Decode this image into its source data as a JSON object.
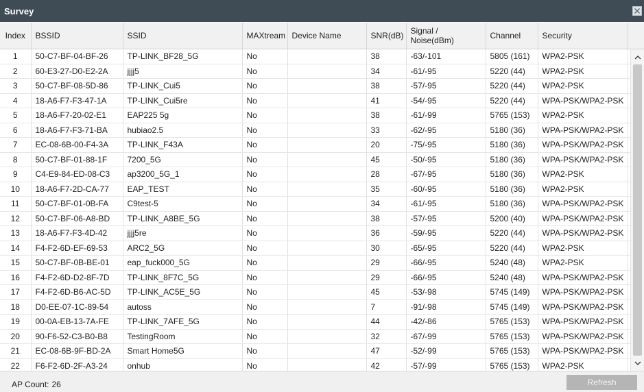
{
  "window": {
    "title": "Survey"
  },
  "table": {
    "headers": {
      "index": "Index",
      "bssid": "BSSID",
      "ssid": "SSID",
      "maxtream": "MAXtream",
      "device_name": "Device Name",
      "snr": "SNR(dB)",
      "signal_line1": "Signal /",
      "signal_line2": "Noise(dBm)",
      "channel": "Channel",
      "security": "Security"
    },
    "rows": [
      {
        "index": "1",
        "bssid": "50-C7-BF-04-BF-26",
        "ssid": "TP-LINK_BF28_5G",
        "maxtream": "No",
        "device_name": "",
        "snr": "38",
        "signal": "-63/-101",
        "channel": "5805 (161)",
        "security": "WPA2-PSK"
      },
      {
        "index": "2",
        "bssid": "60-E3-27-D0-E2-2A",
        "ssid": "jjjj5",
        "maxtream": "No",
        "device_name": "",
        "snr": "34",
        "signal": "-61/-95",
        "channel": "5220 (44)",
        "security": "WPA2-PSK"
      },
      {
        "index": "3",
        "bssid": "50-C7-BF-08-5D-86",
        "ssid": "TP-LINK_Cui5",
        "maxtream": "No",
        "device_name": "",
        "snr": "38",
        "signal": "-57/-95",
        "channel": "5220 (44)",
        "security": "WPA2-PSK"
      },
      {
        "index": "4",
        "bssid": "18-A6-F7-F3-47-1A",
        "ssid": "TP-LINK_Cui5re",
        "maxtream": "No",
        "device_name": "",
        "snr": "41",
        "signal": "-54/-95",
        "channel": "5220 (44)",
        "security": "WPA-PSK/WPA2-PSK"
      },
      {
        "index": "5",
        "bssid": "18-A6-F7-20-02-E1",
        "ssid": "EAP225 5g",
        "maxtream": "No",
        "device_name": "",
        "snr": "38",
        "signal": "-61/-99",
        "channel": "5765 (153)",
        "security": "WPA2-PSK"
      },
      {
        "index": "6",
        "bssid": "18-A6-F7-F3-71-BA",
        "ssid": "hubiao2.5",
        "maxtream": "No",
        "device_name": "",
        "snr": "33",
        "signal": "-62/-95",
        "channel": "5180 (36)",
        "security": "WPA-PSK/WPA2-PSK"
      },
      {
        "index": "7",
        "bssid": "EC-08-6B-00-F4-3A",
        "ssid": "TP-LINK_F43A",
        "maxtream": "No",
        "device_name": "",
        "snr": "20",
        "signal": "-75/-95",
        "channel": "5180 (36)",
        "security": "WPA-PSK/WPA2-PSK"
      },
      {
        "index": "8",
        "bssid": "50-C7-BF-01-88-1F",
        "ssid": "7200_5G",
        "maxtream": "No",
        "device_name": "",
        "snr": "45",
        "signal": "-50/-95",
        "channel": "5180 (36)",
        "security": "WPA-PSK/WPA2-PSK"
      },
      {
        "index": "9",
        "bssid": "C4-E9-84-ED-08-C3",
        "ssid": "ap3200_5G_1",
        "maxtream": "No",
        "device_name": "",
        "snr": "28",
        "signal": "-67/-95",
        "channel": "5180 (36)",
        "security": "WPA2-PSK"
      },
      {
        "index": "10",
        "bssid": "18-A6-F7-2D-CA-77",
        "ssid": "EAP_TEST",
        "maxtream": "No",
        "device_name": "",
        "snr": "35",
        "signal": "-60/-95",
        "channel": "5180 (36)",
        "security": "WPA2-PSK"
      },
      {
        "index": "11",
        "bssid": "50-C7-BF-01-0B-FA",
        "ssid": "C9test-5",
        "maxtream": "No",
        "device_name": "",
        "snr": "34",
        "signal": "-61/-95",
        "channel": "5180 (36)",
        "security": "WPA-PSK/WPA2-PSK"
      },
      {
        "index": "12",
        "bssid": "50-C7-BF-06-A8-BD",
        "ssid": "TP-LINK_A8BE_5G",
        "maxtream": "No",
        "device_name": "",
        "snr": "38",
        "signal": "-57/-95",
        "channel": "5200 (40)",
        "security": "WPA-PSK/WPA2-PSK"
      },
      {
        "index": "13",
        "bssid": "18-A6-F7-F3-4D-42",
        "ssid": "jjjj5re",
        "maxtream": "No",
        "device_name": "",
        "snr": "36",
        "signal": "-59/-95",
        "channel": "5220 (44)",
        "security": "WPA-PSK/WPA2-PSK"
      },
      {
        "index": "14",
        "bssid": "F4-F2-6D-EF-69-53",
        "ssid": "ARC2_5G",
        "maxtream": "No",
        "device_name": "",
        "snr": "30",
        "signal": "-65/-95",
        "channel": "5220 (44)",
        "security": "WPA2-PSK"
      },
      {
        "index": "15",
        "bssid": "50-C7-BF-0B-BE-01",
        "ssid": "eap_fuck000_5G",
        "maxtream": "No",
        "device_name": "",
        "snr": "29",
        "signal": "-66/-95",
        "channel": "5240 (48)",
        "security": "WPA2-PSK"
      },
      {
        "index": "16",
        "bssid": "F4-F2-6D-D2-8F-7D",
        "ssid": "TP-LINK_8F7C_5G",
        "maxtream": "No",
        "device_name": "",
        "snr": "29",
        "signal": "-66/-95",
        "channel": "5240 (48)",
        "security": "WPA-PSK/WPA2-PSK"
      },
      {
        "index": "17",
        "bssid": "F4-F2-6D-B6-AC-5D",
        "ssid": "TP-LINK_AC5E_5G",
        "maxtream": "No",
        "device_name": "",
        "snr": "45",
        "signal": "-53/-98",
        "channel": "5745 (149)",
        "security": "WPA-PSK/WPA2-PSK"
      },
      {
        "index": "18",
        "bssid": "D0-EE-07-1C-89-54",
        "ssid": "autoss",
        "maxtream": "No",
        "device_name": "",
        "snr": "7",
        "signal": "-91/-98",
        "channel": "5745 (149)",
        "security": "WPA-PSK/WPA2-PSK"
      },
      {
        "index": "19",
        "bssid": "00-0A-EB-13-7A-FE",
        "ssid": "TP-LINK_7AFE_5G",
        "maxtream": "No",
        "device_name": "",
        "snr": "44",
        "signal": "-42/-86",
        "channel": "5765 (153)",
        "security": "WPA-PSK/WPA2-PSK"
      },
      {
        "index": "20",
        "bssid": "90-F6-52-C3-B0-B8",
        "ssid": "TestingRoom",
        "maxtream": "No",
        "device_name": "",
        "snr": "32",
        "signal": "-67/-99",
        "channel": "5765 (153)",
        "security": "WPA-PSK/WPA2-PSK"
      },
      {
        "index": "21",
        "bssid": "EC-08-6B-9F-BD-2A",
        "ssid": "Smart Home5G",
        "maxtream": "No",
        "device_name": "",
        "snr": "47",
        "signal": "-52/-99",
        "channel": "5765 (153)",
        "security": "WPA-PSK/WPA2-PSK"
      },
      {
        "index": "22",
        "bssid": "F6-F2-6D-2F-A3-24",
        "ssid": "onhub",
        "maxtream": "No",
        "device_name": "",
        "snr": "42",
        "signal": "-57/-99",
        "channel": "5765 (153)",
        "security": "WPA2-PSK"
      }
    ]
  },
  "footer": {
    "ap_count_label": "AP Count:",
    "ap_count_value": "26",
    "refresh_label": "Refresh"
  },
  "icons": {
    "close": "close-icon",
    "scroll_up": "chevron-up-icon",
    "scroll_down": "chevron-down-icon"
  }
}
